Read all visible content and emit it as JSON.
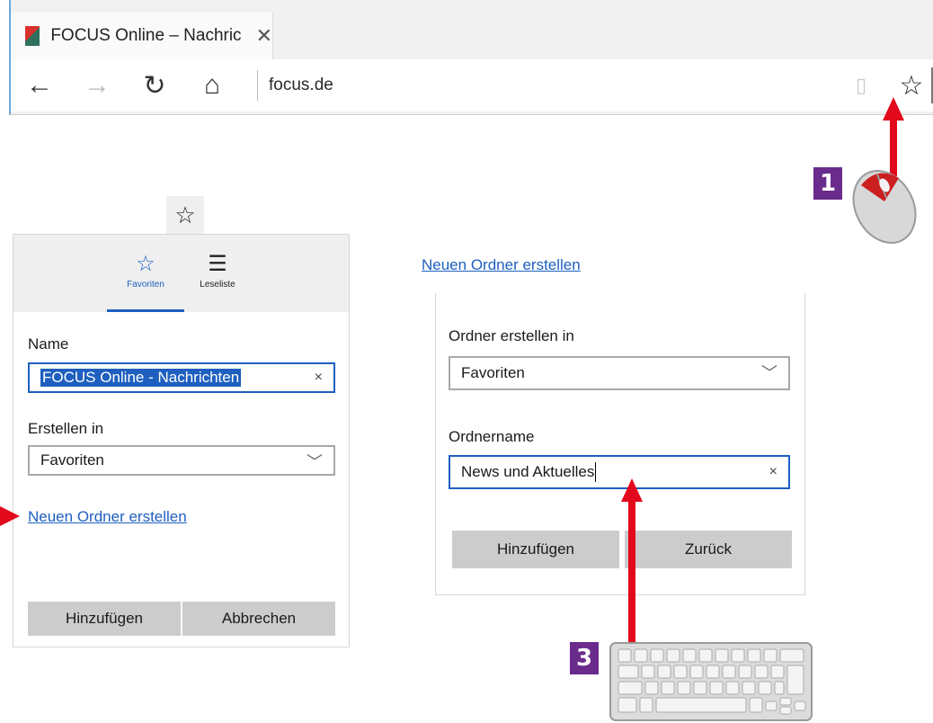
{
  "browser": {
    "tab_title": "FOCUS Online – Nachric",
    "tab_close": "✕",
    "back": "←",
    "forward": "→",
    "refresh": "↻",
    "home": "⌂",
    "address": "focus.de",
    "reading_icon": "▯",
    "favorite": "☆"
  },
  "badges": {
    "step1": "1",
    "step3": "3"
  },
  "left_panel": {
    "star": "☆",
    "tabs": [
      {
        "icon": "☆",
        "label": "Favoriten"
      },
      {
        "icon": "☰",
        "label": "Leseliste"
      }
    ],
    "name_label": "Name",
    "name_value": "FOCUS Online - Nachrichten",
    "create_in_label": "Erstellen in",
    "create_in_value": "Favoriten",
    "new_folder_link": "Neuen Ordner erstellen",
    "add_button": "Hinzufügen",
    "cancel_button": "Abbrechen",
    "clear_icon": "×",
    "chevron_icon": "﹀"
  },
  "right_panel": {
    "new_folder_link": "Neuen Ordner erstellen",
    "create_in_label": "Ordner erstellen in",
    "create_in_value": "Favoriten",
    "folder_name_label": "Ordnername",
    "folder_name_value": "News und Aktuelles",
    "add_button": "Hinzufügen",
    "back_button": "Zurück",
    "clear_icon": "×",
    "chevron_icon": "﹀"
  },
  "colors": {
    "accent": "#1e5fbf",
    "arrow": "#e2091c",
    "badge": "#6a2c8c"
  }
}
